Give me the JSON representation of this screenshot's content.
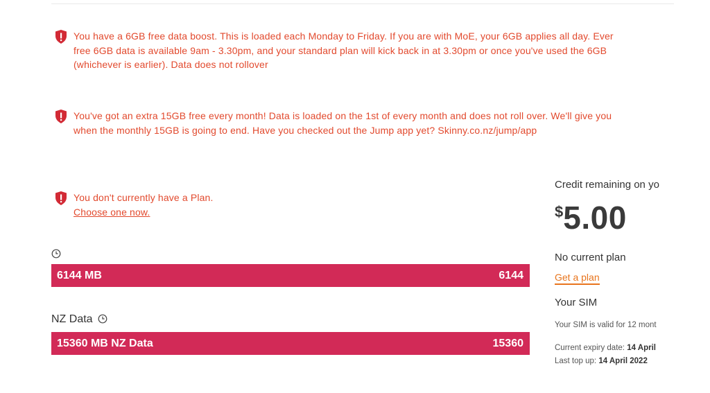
{
  "alerts": [
    {
      "lines": [
        "You have a 6GB free data boost. This is loaded each Monday to Friday. If you are with MoE, your 6GB applies all day. Ever",
        "free 6GB data is available 9am - 3.30pm, and your standard plan will kick back in at 3.30pm or once you've used the 6GB",
        "(whichever is earlier). Data does not rollover"
      ]
    },
    {
      "lines": [
        "You've got an extra 15GB free every month! Data is loaded on the 1st of every month and does not roll over. We'll give you",
        "when the monthly 15GB is going to end. Have you checked out the Jump app yet? Skinny.co.nz/jump/app"
      ]
    },
    {
      "lines": [
        "You don't currently have a Plan."
      ],
      "link": "Choose one now."
    }
  ],
  "balances": [
    {
      "label": "",
      "bar_label": "6144 MB",
      "bar_value": "6144",
      "fill_fraction": 1.0
    },
    {
      "label": "NZ Data",
      "bar_label": "15360 MB NZ Data",
      "bar_value": "15360",
      "fill_fraction": 1.0
    }
  ],
  "sidebar": {
    "credit_title": "Credit remaining on yo",
    "credit_currency": "$",
    "credit_amount": "5.00",
    "plan_status": "No current plan",
    "get_plan_link": "Get a plan",
    "sim_title": "Your SIM",
    "sim_valid": "Your SIM is valid for 12 mont",
    "expiry_label": "Current expiry date:",
    "expiry_value": "14 April",
    "topup_label": "Last top up:",
    "topup_value": "14 April 2022"
  },
  "colors": {
    "alert_text": "#e2492d",
    "alert_icon": "#d22a35",
    "bar": "#d22a57",
    "link_orange": "#e8741c"
  },
  "icons": {
    "alert": "shield-exclamation-icon",
    "timer": "clock-icon"
  }
}
